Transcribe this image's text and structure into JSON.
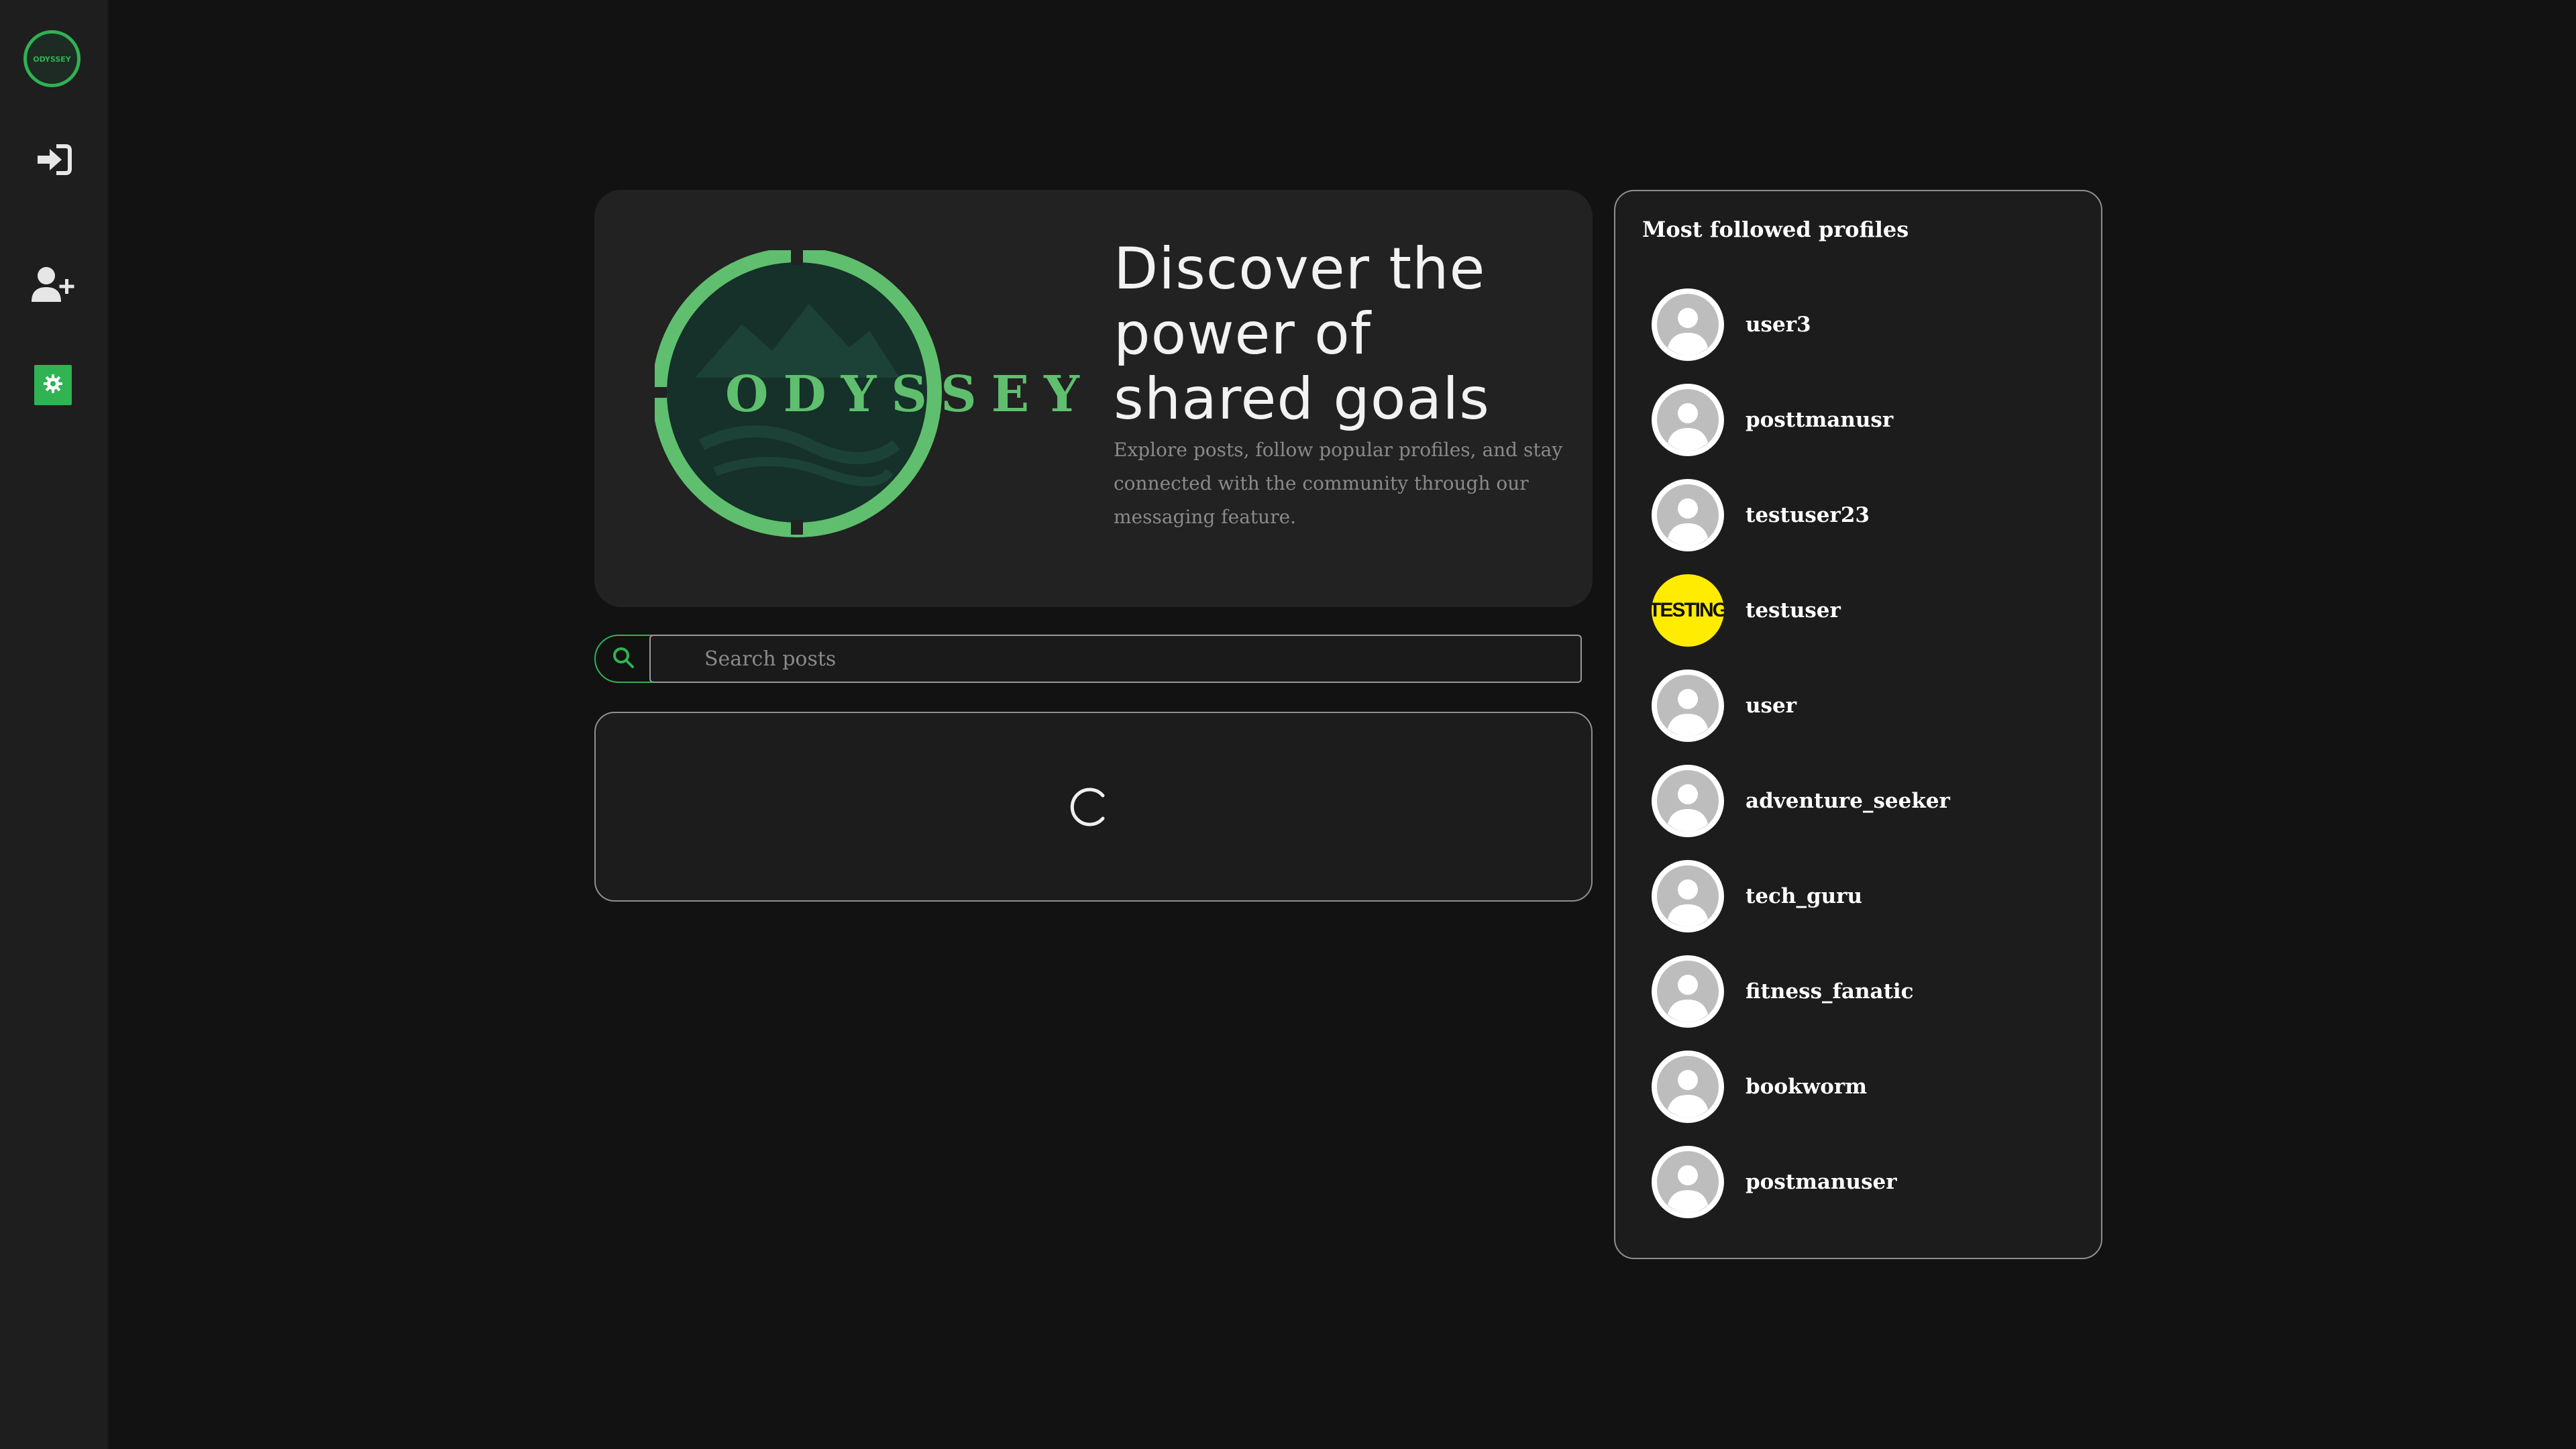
{
  "sidebar": {
    "logo_text": "ODYSSEY",
    "items": [
      {
        "icon": "sign-in-icon"
      },
      {
        "icon": "user-plus-icon"
      },
      {
        "icon": "gear-icon",
        "active": true
      }
    ],
    "accent": "#2fb353"
  },
  "hero": {
    "logo_text": "ODYSSEY",
    "title": "Discover the power of shared goals",
    "description": "Explore posts, follow popular profiles, and stay connected with the community through our messaging feature."
  },
  "search": {
    "placeholder": "Search posts",
    "value": ""
  },
  "posts": {
    "state": "loading"
  },
  "profiles": {
    "title": "Most followed profiles",
    "items": [
      {
        "username": "user3",
        "avatar": "default"
      },
      {
        "username": "posttmanusr",
        "avatar": "default"
      },
      {
        "username": "testuser23",
        "avatar": "default"
      },
      {
        "username": "testuser",
        "avatar": "testing",
        "avatar_text": "TESTING"
      },
      {
        "username": "user",
        "avatar": "default"
      },
      {
        "username": "adventure_seeker",
        "avatar": "default"
      },
      {
        "username": "tech_guru",
        "avatar": "default"
      },
      {
        "username": "fitness_fanatic",
        "avatar": "default"
      },
      {
        "username": "bookworm",
        "avatar": "default"
      },
      {
        "username": "postmanuser",
        "avatar": "default"
      }
    ]
  }
}
